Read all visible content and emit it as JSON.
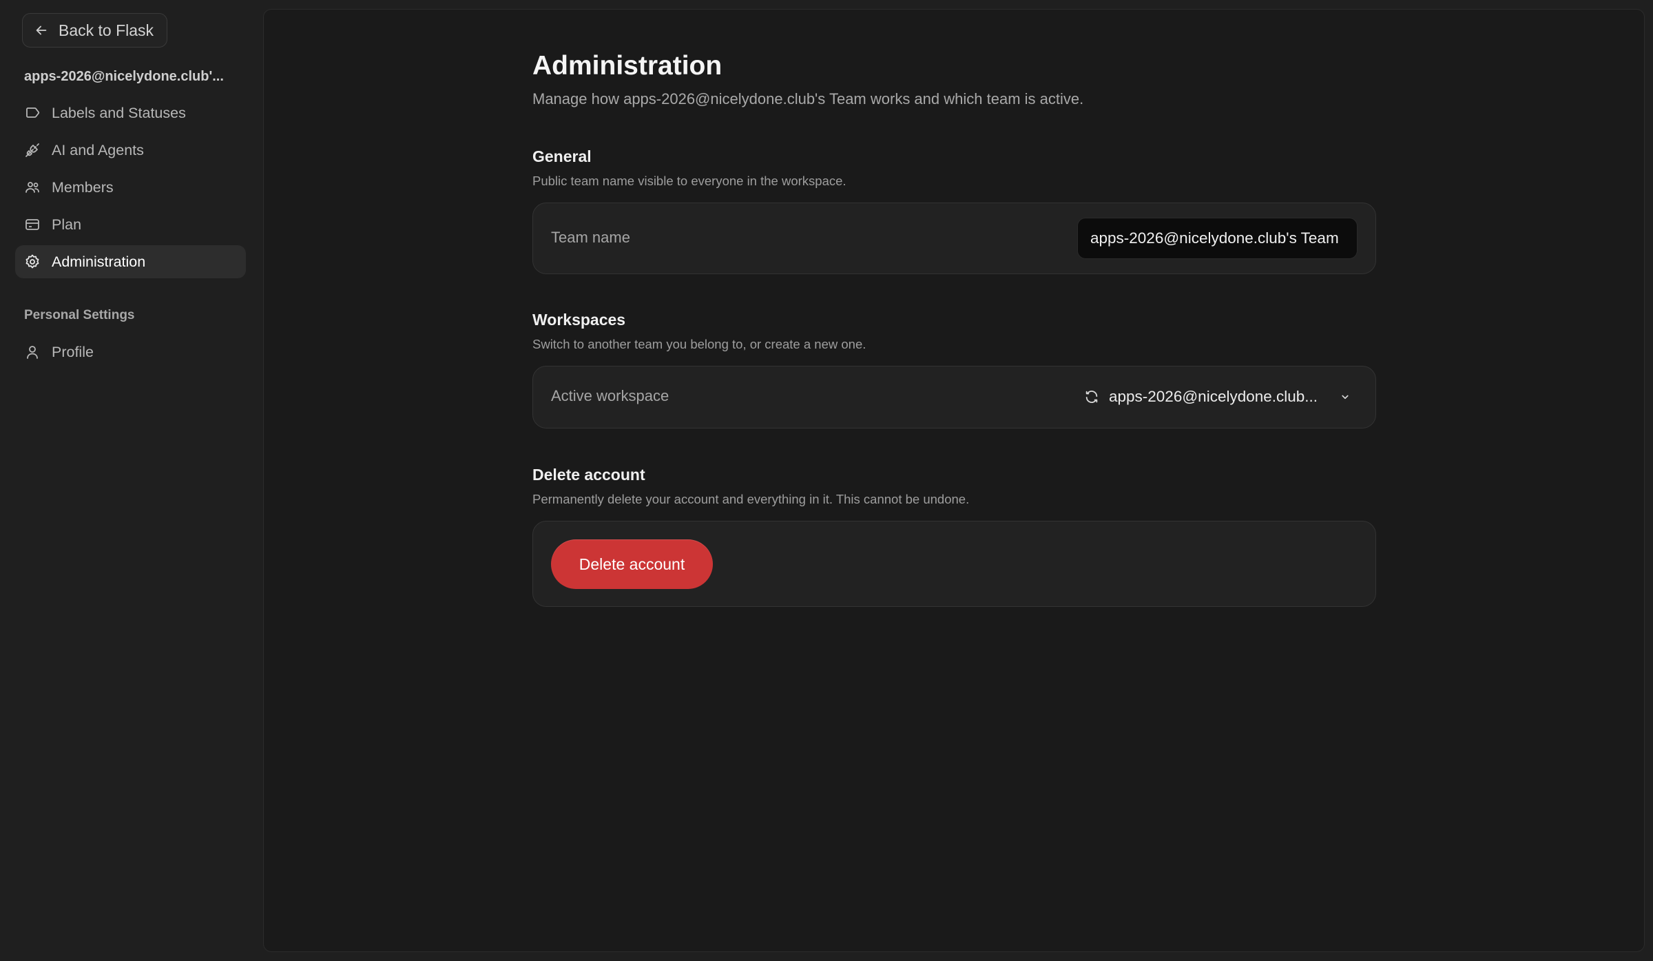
{
  "sidebar": {
    "back_label": "Back to Flask",
    "team_title": "apps-2026@nicelydone.club'...",
    "items": [
      {
        "label": "Labels and Statuses",
        "icon": "tag-icon"
      },
      {
        "label": "AI and Agents",
        "icon": "plug-icon"
      },
      {
        "label": "Members",
        "icon": "members-icon"
      },
      {
        "label": "Plan",
        "icon": "credit-card-icon"
      },
      {
        "label": "Administration",
        "icon": "gear-icon",
        "active": true
      }
    ],
    "personal_section_label": "Personal Settings",
    "personal_items": [
      {
        "label": "Profile",
        "icon": "user-icon"
      }
    ]
  },
  "main": {
    "title": "Administration",
    "subtitle": "Manage how apps-2026@nicelydone.club's Team works and which team is active.",
    "general": {
      "title": "General",
      "description": "Public team name visible to everyone in the workspace.",
      "field_label": "Team name",
      "field_value": "apps-2026@nicelydone.club's Team"
    },
    "workspaces": {
      "title": "Workspaces",
      "description": "Switch to another team you belong to, or create a new one.",
      "field_label": "Active workspace",
      "selected": "apps-2026@nicelydone.club..."
    },
    "delete_account": {
      "title": "Delete account",
      "description": "Permanently delete your account and everything in it. This cannot be undone.",
      "button_label": "Delete account"
    }
  },
  "colors": {
    "background": "#1f1f1f",
    "panel": "#1a1a1a",
    "danger": "#cc3535",
    "active_nav": "#2d2d2d"
  }
}
